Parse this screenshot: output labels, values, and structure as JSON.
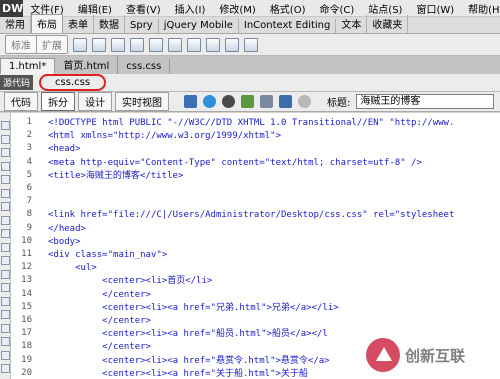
{
  "app": {
    "logo_text": "DW"
  },
  "menu": [
    "文件(F)",
    "编辑(E)",
    "查看(V)",
    "插入(I)",
    "修改(M)",
    "格式(O)",
    "命令(C)",
    "站点(S)",
    "窗口(W)",
    "帮助(H)"
  ],
  "insert_tabs": [
    "常用",
    "布局",
    "表单",
    "数据",
    "Spry",
    "jQuery Mobile",
    "InContext Editing",
    "文本",
    "收藏夹"
  ],
  "insert_active": "布局",
  "layout_modes": {
    "standard": "标准",
    "expanded": "扩展"
  },
  "doc_tabs": [
    "1.html*",
    "首页.html",
    "css.css"
  ],
  "doc_active": "1.html*",
  "related": {
    "source_label": "源代码",
    "file": "css.css"
  },
  "view_buttons": [
    "代码",
    "拆分",
    "设计",
    "实时视图"
  ],
  "view_active": "拆分",
  "title_field": {
    "label": "标题:",
    "value": "海贼王的博客"
  },
  "line_numbers": [
    "1",
    "2",
    "3",
    "4",
    "5",
    "6",
    "7",
    "8",
    "9",
    "10",
    "11",
    "12",
    "13",
    "14",
    "15",
    "16",
    "17",
    "18",
    "19",
    "20"
  ],
  "code_lines": [
    "<!DOCTYPE html PUBLIC \"-//W3C//DTD XHTML 1.0 Transitional//EN\" \"http://www.",
    "<html xmlns=\"http://www.w3.org/1999/xhtml\">",
    "<head>",
    "<meta http-equiv=\"Content-Type\" content=\"text/html; charset=utf-8\" />",
    "<title>海贼王的博客</title>",
    "",
    "",
    "<link href=\"file:///C|/Users/Administrator/Desktop/css.css\" rel=\"stylesheet",
    "</head>",
    "<body>",
    "<div class=\"main_nav\">",
    "     <ul>",
    "          <center><li>首页</li>",
    "          </center>",
    "          <center><li><a href=\"兄弟.html\">兄弟</a></li>",
    "          </center>",
    "          <center><li><a href=\"船员.html\">船员</a></l",
    "          </center>",
    "          <center><li><a href=\"悬赏令.html\">悬赏令</a>",
    "          <center><li><a href=\"关于船.html\">关于船"
  ],
  "watermark_text": "创新互联",
  "colors": {
    "annotation": "#e02020",
    "code_tag": "#1a1acc",
    "watermark": "#c8102e"
  }
}
